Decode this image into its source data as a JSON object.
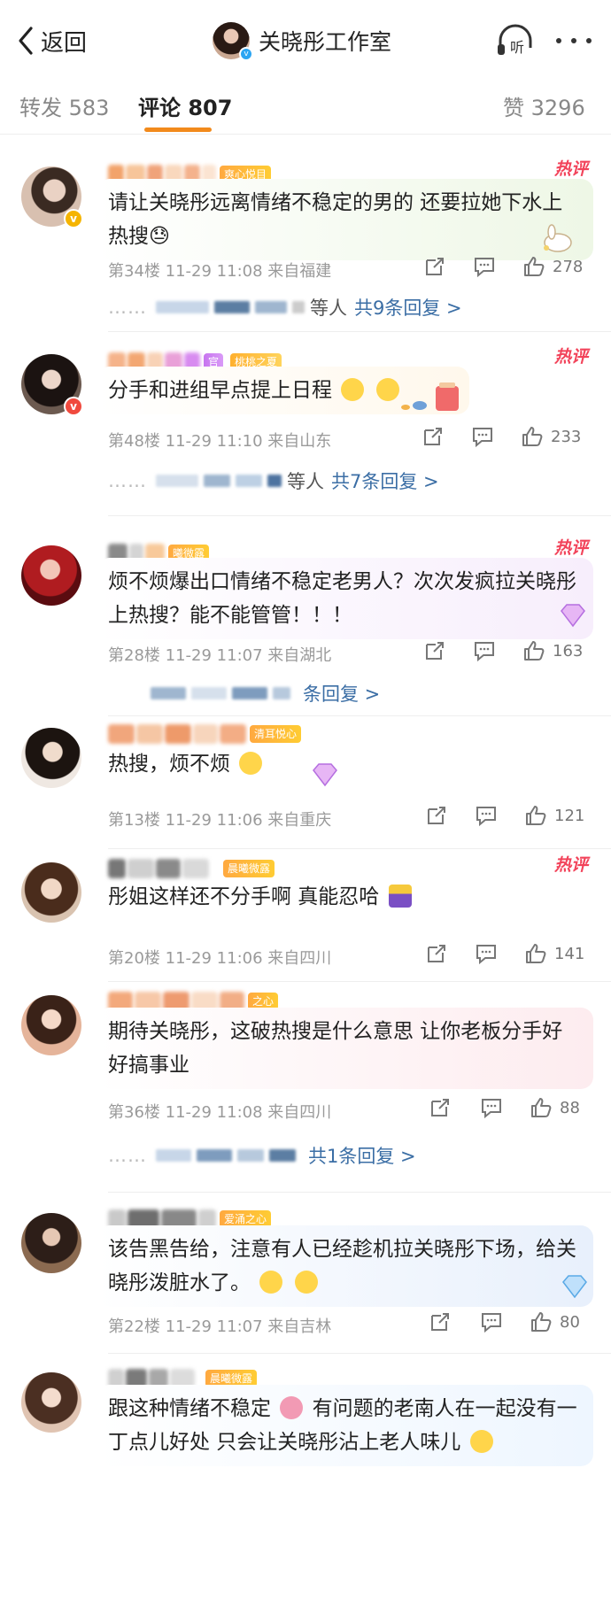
{
  "nav": {
    "back_label": "返回",
    "title": "关晓彤工作室",
    "verified": "v",
    "listen_label": "听"
  },
  "tabs": [
    {
      "label": "转发",
      "count": "583"
    },
    {
      "label": "评论",
      "count": "807"
    },
    {
      "label": "赞",
      "count": "3296"
    }
  ],
  "comments": [
    {
      "badge": "爽心悦目",
      "hot": "热评",
      "text": "请让关晓彤远离情绪不稳定的男的 还要拉她下水上热搜😓",
      "floor": "第34楼",
      "time": "11-29 11:08",
      "location": "来自福建",
      "likes": "278",
      "replies_prefix": "等人",
      "replies_link": "共9条回复 >"
    },
    {
      "badge": "官",
      "badge2": "桃桃之夏",
      "hot": "热评",
      "text": "分手和进组早点提上日程",
      "floor": "第48楼",
      "time": "11-29 11:10",
      "location": "来自山东",
      "likes": "233",
      "replies_prefix": "等人",
      "replies_link": "共7条回复 >"
    },
    {
      "badge": "曦微露",
      "hot": "热评",
      "text": "烦不烦爆出口情绪不稳定老男人？次次发疯拉关晓彤上热搜？能不能管管！！！",
      "floor": "第28楼",
      "time": "11-29 11:07",
      "location": "来自湖北",
      "likes": "163",
      "replies_link": "条回复 >"
    },
    {
      "badge": "清耳悦心",
      "text": "热搜，烦不烦",
      "floor": "第13楼",
      "time": "11-29 11:06",
      "location": "来自重庆",
      "likes": "121"
    },
    {
      "badge": "晨曦微露",
      "hot": "热评",
      "text": "彤姐这样还不分手啊 真能忍哈",
      "floor": "第20楼",
      "time": "11-29 11:06",
      "location": "来自四川",
      "likes": "141"
    },
    {
      "badge": "之心",
      "text": "期待关晓彤，这破热搜是什么意思 让你老板分手好好搞事业",
      "floor": "第36楼",
      "time": "11-29 11:08",
      "location": "来自四川",
      "likes": "88",
      "replies_link": "共1条回复 >"
    },
    {
      "badge": "爱涌之心",
      "text": "该告黑告给，注意有人已经趁机拉关晓彤下场，给关晓彤泼脏水了。",
      "floor": "第22楼",
      "time": "11-29 11:07",
      "location": "来自吉林",
      "likes": "80"
    },
    {
      "badge": "晨曦微露",
      "text_a": "跟这种情绪不稳定",
      "text_b": "有问题的老南人在一起没有一丁点儿好处 只会让关晓彤沾上老人味儿"
    }
  ]
}
